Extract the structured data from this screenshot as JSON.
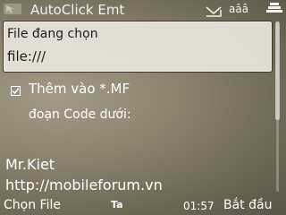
{
  "status_bar": {
    "app_title": "AutoClick Emt",
    "signal_text": "aââ"
  },
  "file_panel": {
    "label": "File đang chọn",
    "value": "file:///"
  },
  "options": {
    "add_mf_checkbox": {
      "label": "Thêm vào *.MF",
      "checked": true
    },
    "code_label": "đoạn Code dưới:"
  },
  "info": {
    "author": "Mr.Kiet",
    "url": "http://mobileforum.vn"
  },
  "softkeys": {
    "left": "Chọn File",
    "input_mode": "Ta",
    "clock": "01:57",
    "right": "Bắt đầu"
  },
  "colors": {
    "panel_bg": "#e9e5dc",
    "background": "#8d8570"
  },
  "icons": [
    "app-menu-icon",
    "envelope-icon",
    "battery-icon",
    "checkbox-checked-icon"
  ]
}
